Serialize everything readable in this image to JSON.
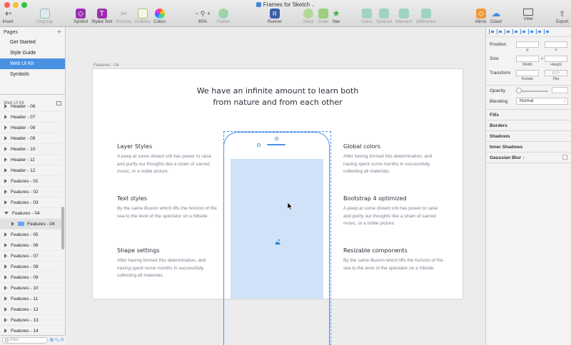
{
  "window": {
    "title": "Frames for Sketch"
  },
  "toolbar": {
    "insert": "Insert",
    "ungroup": "Ungroup",
    "symbol": "Symbol",
    "styled_text": "Styled Text",
    "scissors": "Scissors",
    "outlines": "Outlines",
    "colors": "Colors",
    "zoom": "65%",
    "flatten": "Flatten",
    "runner": "Runner",
    "mask": "Mask",
    "scale": "Scale",
    "star": "Star",
    "union": "Union",
    "subtract": "Subtract",
    "intersect": "Intersect",
    "difference": "Difference",
    "mirror": "Mirror",
    "cloud": "Cloud",
    "view": "View",
    "export": "Export"
  },
  "sidebar": {
    "pages_title": "Pages",
    "pages": [
      "Get Started",
      "Style Guide",
      "Web UI Kit",
      "Symbols"
    ],
    "active_page": "Web UI Kit",
    "layers_title": "Web UI Kit",
    "layers": [
      "Header - 06",
      "Header - 07",
      "Header - 08",
      "Header - 09",
      "Header - 10",
      "Header - 11",
      "Header - 12",
      "Features - 01",
      "Features - 02",
      "Features - 03",
      "Features - 04",
      "Features - 04",
      "Features - 05",
      "Features - 06",
      "Features - 07",
      "Features - 08",
      "Features - 09",
      "Features - 10",
      "Features - 11",
      "Features - 12",
      "Features - 13",
      "Features - 14"
    ],
    "filter_placeholder": "Filter"
  },
  "canvas": {
    "artboard_label": "Features - 04",
    "headline_1": "We have an infinite amount to learn both",
    "headline_2": "from nature and from each other",
    "features": [
      {
        "title": "Layer Styles",
        "body": "A peep at some distant orb has power to raise and purify our thoughts like a strain of sacred music, or a noble picture."
      },
      {
        "title": "Text styles",
        "body": "By the same illusion which lifts the horizon of the sea to the level of the spectator on a hillside."
      },
      {
        "title": "Shape settings",
        "body": "After having formed this determination, and having spent some months in successfully collecting all materials."
      },
      {
        "title": "Global colors",
        "body": "After having formed this determination, and having spent some months in successfully collecting all materials."
      },
      {
        "title": "Bootstrap 4 optimized",
        "body": "A peep at some distant orb has power to raise and purify our thoughts like a strain of sacred music, or a noble picture."
      },
      {
        "title": "Resizable components",
        "body": "By the same illusion which lifts the horizon of the sea to the level of the spectator on a hillside."
      }
    ]
  },
  "inspector": {
    "position": "Position",
    "x": "X",
    "y": "Y",
    "size": "Size",
    "width": "Width",
    "height": "Height",
    "transform": "Transform",
    "rotate": "Rotate",
    "flip": "Flip",
    "opacity": "Opacity",
    "blending": "Blending",
    "blending_value": "Normal",
    "fills": "Fills",
    "borders": "Borders",
    "shadows": "Shadows",
    "inner_shadows": "Inner Shadows",
    "gaussian_blur": "Gaussian Blur"
  },
  "colors": {
    "accent": "#4a90e2",
    "screen": "#cfe2f8"
  }
}
